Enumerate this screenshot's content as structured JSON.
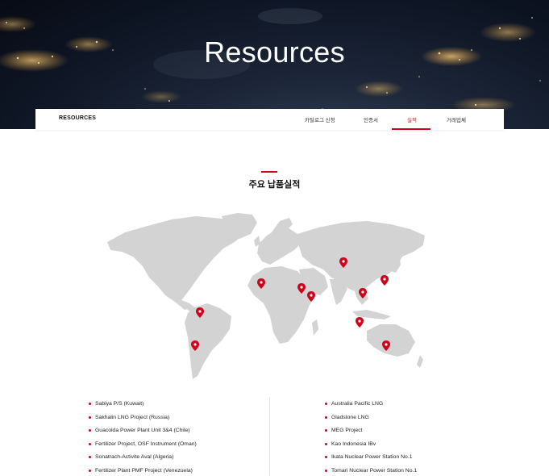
{
  "hero": {
    "title": "Resources"
  },
  "subnav": {
    "brand": "RESOURCES",
    "items": [
      {
        "label": "카탈로그 신청"
      },
      {
        "label": "인증서"
      },
      {
        "label": "실적",
        "active": true
      },
      {
        "label": "거래업체"
      }
    ]
  },
  "section": {
    "title": "주요 납품실적"
  },
  "map": {
    "land_color": "#d3d3d3",
    "pin_color": "#d0021b",
    "pin_icon": "map-pin-icon"
  },
  "projects_left": [
    "Sabiya P/S (Kuwait)",
    "Sakhalin LNG Project (Russia)",
    "Guacolda Power Plant Unit 3&4 (Chile)",
    "Fertilizer Project, OSF Instrument (Oman)",
    "Sonatrach-Activite Aval (Algeria)",
    "Fertilizer Plant  PMF Project (Venezuela)"
  ],
  "projects_right": [
    "Australia Pacific LNG",
    "Gladstone LNG",
    "MEG Project",
    "Kao Indonesia IBv",
    "Ikata Nuclear Power Station No.1",
    "Tomari Nuclear Power Station No.1"
  ],
  "colors": {
    "accent": "#d0021b"
  }
}
